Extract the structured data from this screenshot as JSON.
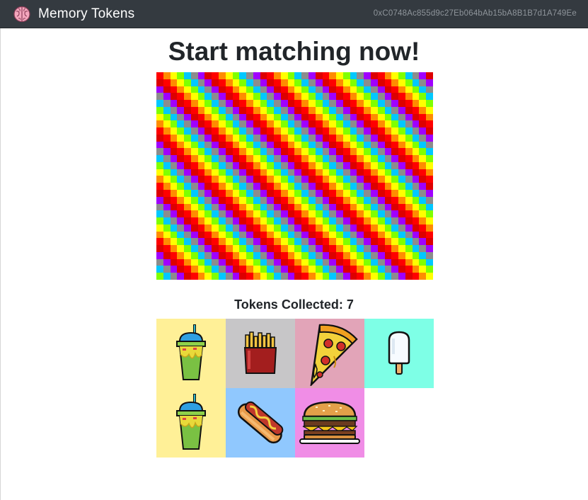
{
  "navbar": {
    "brand_name": "Memory Tokens",
    "brand_icon": "brain-icon",
    "account_address": "0xC0748Ac855d9c27Eb064bAb15bA8B1B7d1A749Ee"
  },
  "main": {
    "title": "Start matching now!",
    "tokens_collected_label": "Tokens Collected: 7",
    "tokens": [
      {
        "name": "drink",
        "icon": "drink-icon",
        "bg": "#fff097"
      },
      {
        "name": "fries",
        "icon": "fries-icon",
        "bg": "#c7c6c8"
      },
      {
        "name": "pizza",
        "icon": "pizza-icon",
        "bg": "#e2a4b8"
      },
      {
        "name": "ice-cream",
        "icon": "ice-cream-icon",
        "bg": "#7effe6"
      },
      {
        "name": "drink",
        "icon": "drink-icon",
        "bg": "#fff097"
      },
      {
        "name": "hotdog",
        "icon": "hotdog-icon",
        "bg": "#90c8fe"
      },
      {
        "name": "burger",
        "icon": "burger-icon",
        "bg": "#f08de6"
      }
    ]
  },
  "colors": {
    "navbar_bg": "#343a40",
    "board_palette": [
      "#ff0000",
      "#ff8c00",
      "#ffff00",
      "#7fff00",
      "#00c8ff",
      "#8c8c8c",
      "#a000ff",
      "#dd0000"
    ]
  }
}
